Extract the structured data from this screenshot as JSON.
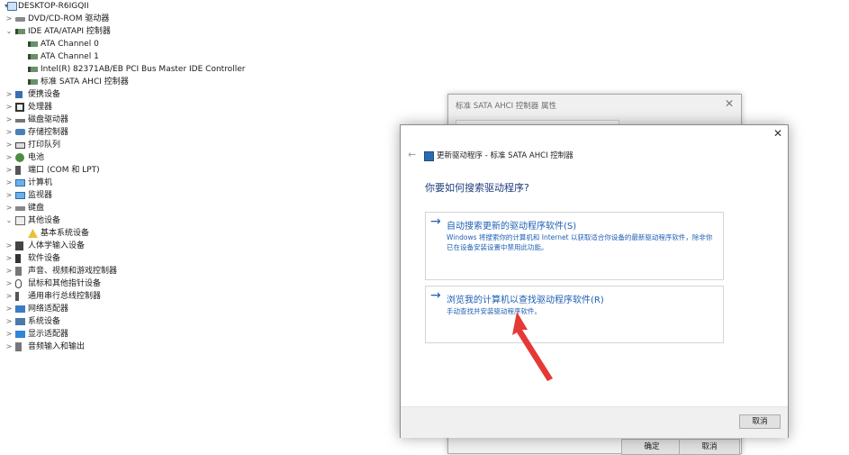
{
  "tree": {
    "items": [
      {
        "label": "DESKTOP-R6IGQII",
        "icon": "computer-icon",
        "exp": "▾",
        "indent": 0
      },
      {
        "label": "DVD/CD-ROM 驱动器",
        "icon": "disk-icon",
        "exp": ">",
        "indent": 1
      },
      {
        "label": "IDE ATA/ATAPI 控制器",
        "icon": "ide-controller-icon",
        "exp": "⌄",
        "indent": 1
      },
      {
        "label": "ATA Channel 0",
        "icon": "ide-controller-icon",
        "exp": "",
        "indent": 2
      },
      {
        "label": "ATA Channel 1",
        "icon": "ide-controller-icon",
        "exp": "",
        "indent": 2
      },
      {
        "label": "Intel(R) 82371AB/EB PCI Bus Master IDE Controller",
        "icon": "ide-controller-icon",
        "exp": "",
        "indent": 2
      },
      {
        "label": "标准 SATA AHCI 控制器",
        "icon": "ide-controller-icon",
        "exp": "",
        "indent": 2
      },
      {
        "label": "便携设备",
        "icon": "portable-device-icon",
        "exp": ">",
        "indent": 1
      },
      {
        "label": "处理器",
        "icon": "processor-icon",
        "exp": ">",
        "indent": 1
      },
      {
        "label": "磁盘驱动器",
        "icon": "disk-drive-icon",
        "exp": ">",
        "indent": 1
      },
      {
        "label": "存储控制器",
        "icon": "storage-controller-icon",
        "exp": ">",
        "indent": 1
      },
      {
        "label": "打印队列",
        "icon": "printer-icon",
        "exp": ">",
        "indent": 1
      },
      {
        "label": "电池",
        "icon": "battery-icon",
        "exp": ">",
        "indent": 1
      },
      {
        "label": "端口 (COM 和 LPT)",
        "icon": "port-icon",
        "exp": ">",
        "indent": 1
      },
      {
        "label": "计算机",
        "icon": "computer-monitor-icon",
        "exp": ">",
        "indent": 1
      },
      {
        "label": "监视器",
        "icon": "monitor-icon",
        "exp": ">",
        "indent": 1
      },
      {
        "label": "键盘",
        "icon": "keyboard-icon",
        "exp": ">",
        "indent": 1
      },
      {
        "label": "其他设备",
        "icon": "other-device-icon",
        "exp": "⌄",
        "indent": 1
      },
      {
        "label": "基本系统设备",
        "icon": "warning-icon",
        "exp": "",
        "indent": 2
      },
      {
        "label": "人体学输入设备",
        "icon": "hid-icon",
        "exp": ">",
        "indent": 1
      },
      {
        "label": "软件设备",
        "icon": "software-device-icon",
        "exp": ">",
        "indent": 1
      },
      {
        "label": "声音、视频和游戏控制器",
        "icon": "audio-icon",
        "exp": ">",
        "indent": 1
      },
      {
        "label": "鼠标和其他指针设备",
        "icon": "mouse-icon",
        "exp": ">",
        "indent": 1
      },
      {
        "label": "通用串行总线控制器",
        "icon": "usb-icon",
        "exp": ">",
        "indent": 1
      },
      {
        "label": "网络适配器",
        "icon": "network-icon",
        "exp": ">",
        "indent": 1
      },
      {
        "label": "系统设备",
        "icon": "system-device-icon",
        "exp": ">",
        "indent": 1
      },
      {
        "label": "显示适配器",
        "icon": "display-adapter-icon",
        "exp": ">",
        "indent": 1
      },
      {
        "label": "音频输入和输出",
        "icon": "speaker-icon",
        "exp": ">",
        "indent": 1
      }
    ]
  },
  "props_window": {
    "title": "标准 SATA AHCI 控制器 属性",
    "close": "✕",
    "ok_label": "确定",
    "cancel_label": "取消"
  },
  "dialog": {
    "close": "✕",
    "back": "←",
    "header": "更新驱动程序 - 标准 SATA AHCI 控制器",
    "question": "你要如何搜索驱动程序?",
    "option1": {
      "arrow": "→",
      "title": "自动搜索更新的驱动程序软件(S)",
      "desc": "Windows 将搜索你的计算机和 Internet 以获取适合你设备的最新驱动程序软件，除非你已在设备安装设置中禁用此功能。"
    },
    "option2": {
      "arrow": "→",
      "title": "浏览我的计算机以查找驱动程序软件(R)",
      "desc": "手动查找并安装驱动程序软件。"
    },
    "cancel_label": "取消"
  },
  "colors": {
    "link_blue": "#1e5fb4",
    "annotation_red": "#e53935"
  }
}
